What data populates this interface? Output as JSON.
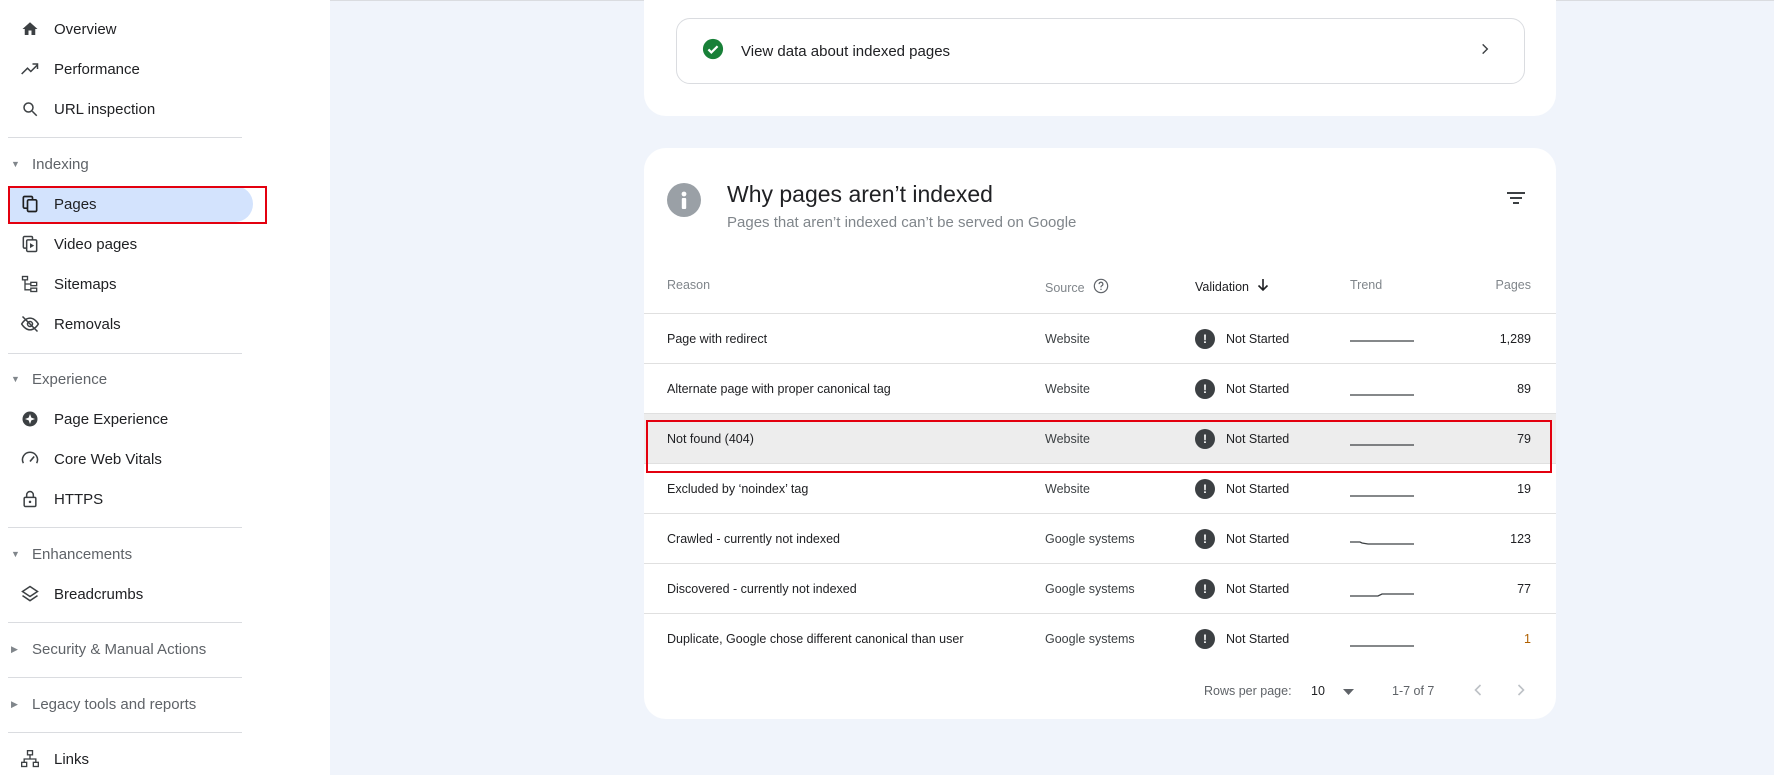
{
  "sidebar": {
    "overview": "Overview",
    "performance": "Performance",
    "url_inspection": "URL inspection",
    "indexing_section": "Indexing",
    "pages": "Pages",
    "video_pages": "Video pages",
    "sitemaps": "Sitemaps",
    "removals": "Removals",
    "experience_section": "Experience",
    "page_experience": "Page Experience",
    "core_web_vitals": "Core Web Vitals",
    "https": "HTTPS",
    "enhancements_section": "Enhancements",
    "breadcrumbs": "Breadcrumbs",
    "security_section": "Security & Manual Actions",
    "legacy_section": "Legacy tools and reports",
    "links": "Links"
  },
  "indexed_card": {
    "label": "View data about indexed pages"
  },
  "why_card": {
    "title": "Why pages aren’t indexed",
    "subtitle": "Pages that aren’t indexed can’t be served on Google",
    "columns": {
      "reason": "Reason",
      "source": "Source",
      "validation": "Validation",
      "trend": "Trend",
      "pages": "Pages"
    },
    "rows": [
      {
        "reason": "Page with redirect",
        "source": "Website",
        "validation": "Not Started",
        "pages": "1,289"
      },
      {
        "reason": "Alternate page with proper canonical tag",
        "source": "Website",
        "validation": "Not Started",
        "pages": "89"
      },
      {
        "reason": "Not found (404)",
        "source": "Website",
        "validation": "Not Started",
        "pages": "79"
      },
      {
        "reason": "Excluded by ‘noindex’ tag",
        "source": "Website",
        "validation": "Not Started",
        "pages": "19"
      },
      {
        "reason": "Crawled - currently not indexed",
        "source": "Google systems",
        "validation": "Not Started",
        "pages": "123"
      },
      {
        "reason": "Discovered - currently not indexed",
        "source": "Google systems",
        "validation": "Not Started",
        "pages": "77"
      },
      {
        "reason": "Duplicate, Google chose different canonical than user",
        "source": "Google systems",
        "validation": "Not Started",
        "pages": "1"
      }
    ],
    "footer": {
      "rows_per_page_label": "Rows per page:",
      "rows_per_page_value": "10",
      "range": "1-7 of 7"
    }
  },
  "colors": {
    "active_nav": "#d3e3fd",
    "highlight_border": "#e3000f",
    "check_green": "#188038"
  }
}
